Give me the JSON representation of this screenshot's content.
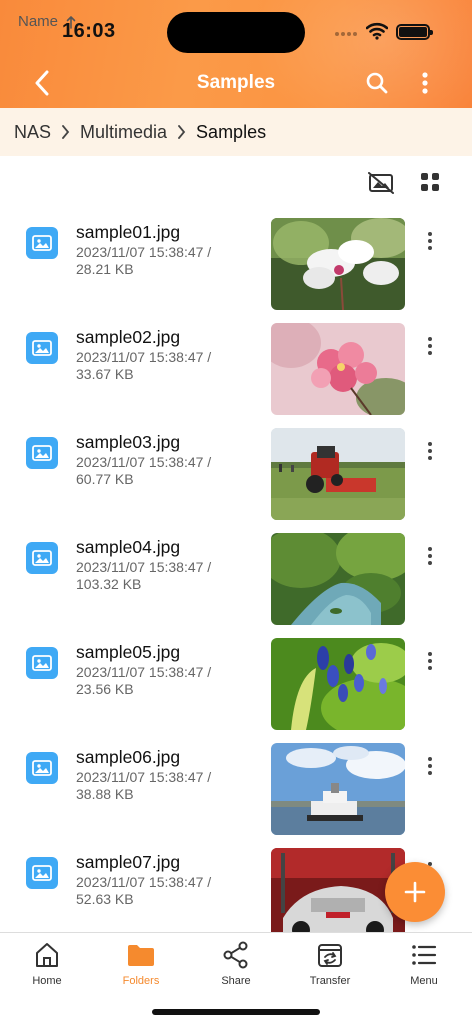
{
  "status": {
    "time": "16:03"
  },
  "header": {
    "title": "Samples"
  },
  "breadcrumb": [
    "NAS",
    "Multimedia",
    "Samples"
  ],
  "sort": {
    "label": "Name",
    "direction": "ascending"
  },
  "files": [
    {
      "name": "sample01.jpg",
      "date": "2023/11/07 15:38:47 /",
      "size": "28.21 KB"
    },
    {
      "name": "sample02.jpg",
      "date": "2023/11/07 15:38:47 /",
      "size": "33.67 KB"
    },
    {
      "name": "sample03.jpg",
      "date": "2023/11/07 15:38:47 /",
      "size": "60.77 KB"
    },
    {
      "name": "sample04.jpg",
      "date": "2023/11/07 15:38:47 /",
      "size": "103.32 KB"
    },
    {
      "name": "sample05.jpg",
      "date": "2023/11/07 15:38:47 /",
      "size": "23.56 KB"
    },
    {
      "name": "sample06.jpg",
      "date": "2023/11/07 15:38:47 /",
      "size": "38.88 KB"
    },
    {
      "name": "sample07.jpg",
      "date": "2023/11/07 15:38:47 /",
      "size": "52.63 KB"
    }
  ],
  "tabs": [
    {
      "label": "Home",
      "icon": "home-icon"
    },
    {
      "label": "Folders",
      "icon": "folder-icon",
      "active": true
    },
    {
      "label": "Share",
      "icon": "share-icon"
    },
    {
      "label": "Transfer",
      "icon": "transfer-icon"
    },
    {
      "label": "Menu",
      "icon": "menu-icon"
    }
  ],
  "colors": {
    "accent": "#fb8d35",
    "fileIcon": "#3fa9f5",
    "breadcrumbBg": "#fdf3e7"
  }
}
